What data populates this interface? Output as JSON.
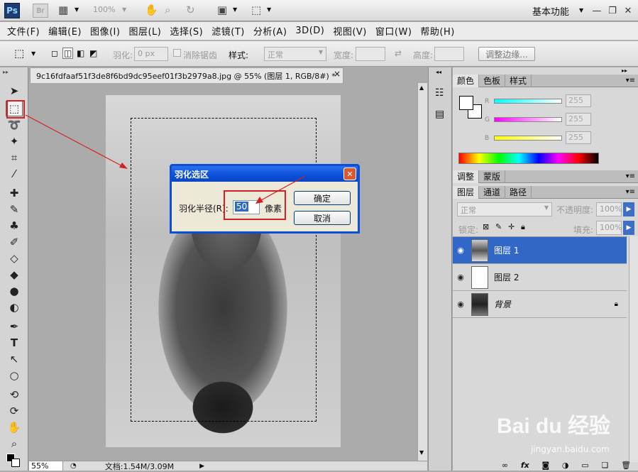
{
  "app": {
    "logo": "Ps",
    "bridge": "Br",
    "zoom": "100%",
    "workspace": "基本功能"
  },
  "menu": [
    "文件(F)",
    "编辑(E)",
    "图像(I)",
    "图层(L)",
    "选择(S)",
    "滤镜(T)",
    "分析(A)",
    "3D(D)",
    "视图(V)",
    "窗口(W)",
    "帮助(H)"
  ],
  "options": {
    "feather_label": "羽化:",
    "feather_value": "0 px",
    "antialias_label": "消除锯齿",
    "style_label": "样式:",
    "style_value": "正常",
    "width_label": "宽度:",
    "height_label": "高度:",
    "refine_button": "调整边缘..."
  },
  "document": {
    "tab_title": "9c16fdfaaf51f3de8f6bd9dc95eef01f3b2979a8.jpg @ 55% (图层 1, RGB/8#) *",
    "close": "×"
  },
  "status": {
    "zoom": "55%",
    "doc_size": "文档:1.54M/3.09M"
  },
  "color_panel": {
    "tabs": [
      "颜色",
      "色板",
      "样式"
    ],
    "channels": [
      {
        "label": "R",
        "value": "255"
      },
      {
        "label": "G",
        "value": "255"
      },
      {
        "label": "B",
        "value": "255"
      }
    ]
  },
  "adjust_panel": {
    "tabs": [
      "调整",
      "蒙版"
    ]
  },
  "layers_panel": {
    "tabs": [
      "图层",
      "通道",
      "路径"
    ],
    "blend_mode": "正常",
    "opacity_label": "不透明度:",
    "opacity_value": "100%",
    "lock_label": "锁定:",
    "fill_label": "填充:",
    "fill_value": "100%",
    "layers": [
      {
        "name": "图层 1",
        "selected": true
      },
      {
        "name": "图层 2",
        "selected": false
      },
      {
        "name": "背景",
        "selected": false,
        "locked": true
      }
    ]
  },
  "dialog": {
    "title": "羽化选区",
    "radius_label": "羽化半径(R):",
    "radius_value": "50",
    "unit": "像素",
    "ok": "确定",
    "cancel": "取消"
  },
  "watermark": {
    "text": "Bai du 经验",
    "url": "jingyan.baidu.com"
  },
  "colors": {
    "dialog_title": "#0b4fd7",
    "selected_layer": "#3168c8",
    "annotation": "#d42020"
  }
}
